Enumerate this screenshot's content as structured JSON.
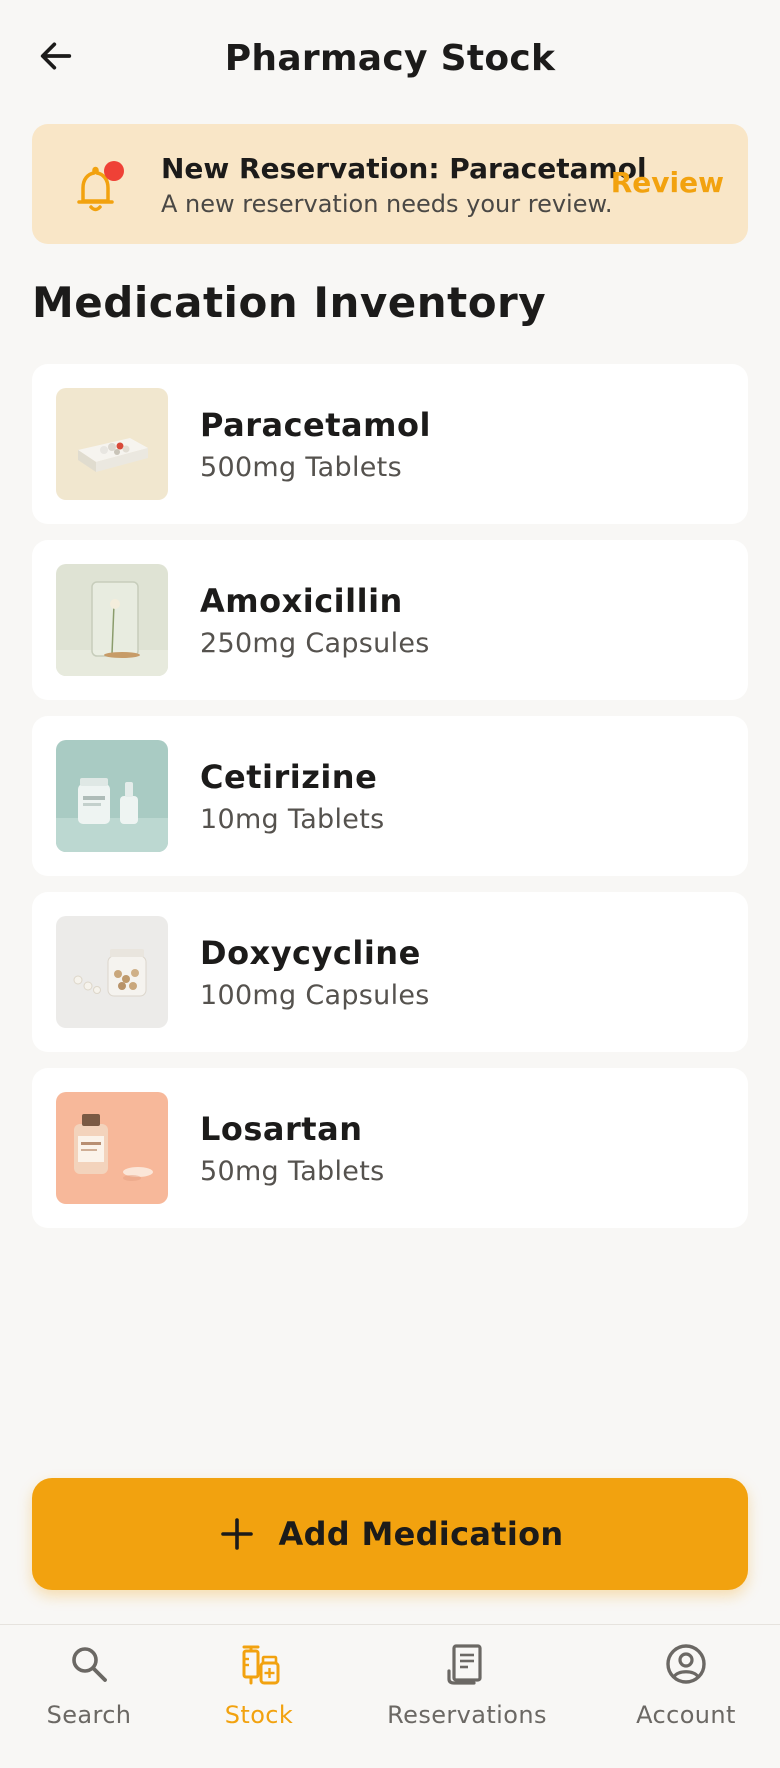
{
  "header": {
    "title": "Pharmacy Stock",
    "back_icon": "arrow-left-icon"
  },
  "notification": {
    "title": "New Reservation: Paracetamol",
    "message": "A new reservation needs your review.",
    "action_label": "Review",
    "icon": "bell-icon",
    "badge_color": "#ef4136"
  },
  "inventory": {
    "section_title": "Medication Inventory",
    "items": [
      {
        "name": "Paracetamol",
        "dosage": "500mg Tablets"
      },
      {
        "name": "Amoxicillin",
        "dosage": "250mg Capsules"
      },
      {
        "name": "Cetirizine",
        "dosage": "10mg Tablets"
      },
      {
        "name": "Doxycycline",
        "dosage": "100mg Capsules"
      },
      {
        "name": "Losartan",
        "dosage": "50mg Tablets"
      }
    ]
  },
  "add_button": {
    "label": "Add Medication",
    "icon": "plus-icon"
  },
  "bottom_nav": {
    "active": "Stock",
    "items": [
      {
        "label": "Search",
        "icon": "search-icon"
      },
      {
        "label": "Stock",
        "icon": "medication-icon"
      },
      {
        "label": "Reservations",
        "icon": "receipt-icon"
      },
      {
        "label": "Account",
        "icon": "account-icon"
      }
    ]
  },
  "colors": {
    "accent": "#f2a20f",
    "banner_bg": "#f9e6c7",
    "background": "#f8f7f5",
    "card_bg": "#ffffff"
  }
}
